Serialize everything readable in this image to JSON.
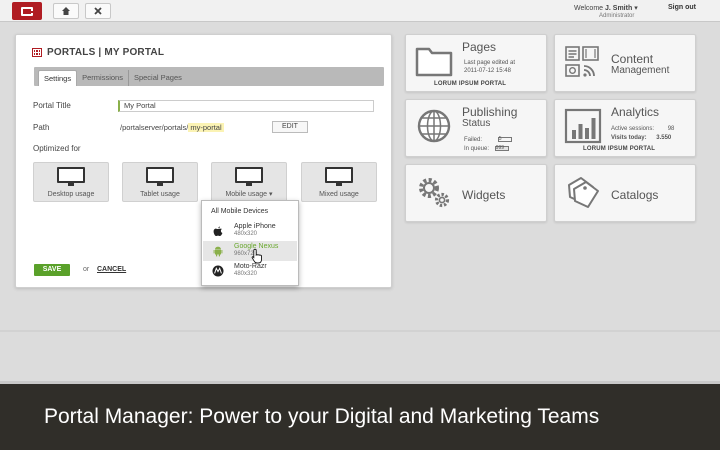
{
  "topbar": {
    "welcome_prefix": "Welcome",
    "user_name": "J. Smith",
    "user_dropdown_glyph": "▾",
    "user_role": "Administrator",
    "sign_out": "Sign out",
    "home_icon": "home-icon",
    "close_icon": "close-icon"
  },
  "portal": {
    "title": "PORTALS | MY PORTAL",
    "tabs": [
      {
        "label": "Settings",
        "active": true
      },
      {
        "label": "Permissions",
        "active": false
      },
      {
        "label": "Special Pages",
        "active": false
      }
    ],
    "portal_title_label": "Portal Title",
    "portal_title_value": "My Portal",
    "path_label": "Path",
    "path_prefix": "/portalserver/portals/",
    "path_highlight": "my-portal",
    "edit_label": "EDIT",
    "optimized_label": "Optimized for",
    "devices": [
      {
        "label": "Desktop usage"
      },
      {
        "label": "Tablet usage"
      },
      {
        "label": "Mobile usage ▾"
      },
      {
        "label": "Mixed usage"
      }
    ],
    "save_label": "SAVE",
    "or_label": "or",
    "cancel_label": "CANCEL",
    "save_color": "#5aa12a"
  },
  "mobile_menu": {
    "header": "All Mobile Devices",
    "items": [
      {
        "name": "Apple iPhone",
        "resolution": "480x320",
        "icon": "apple-icon",
        "selected": false
      },
      {
        "name": "Google Nexus",
        "resolution": "960x720",
        "icon": "android-icon",
        "selected": true
      },
      {
        "name": "Moto-Razr",
        "resolution": "480x320",
        "icon": "motorola-icon",
        "selected": false
      }
    ]
  },
  "tiles": {
    "pages": {
      "title": "Pages",
      "sub1": "Last page edited at",
      "sub2": "2011-07-12 15:48",
      "foot": "LORUM IPSUM PORTAL"
    },
    "content": {
      "title1": "Content",
      "title2": "Management"
    },
    "publishing": {
      "title1": "Publishing",
      "title2": "Status",
      "failed_label": "Failed:",
      "failed_value": "5",
      "queue_label": "In queue:",
      "queue_value": "999"
    },
    "analytics": {
      "title": "Analytics",
      "sessions_label": "Active sessions:",
      "sessions_value": "98",
      "visits_label": "Visits today:",
      "visits_value": "3.550",
      "foot": "LORUM IPSUM PORTAL"
    },
    "widgets": {
      "title": "Widgets"
    },
    "catalogs": {
      "title": "Catalogs"
    }
  },
  "caption": "Portal Manager: Power to your Digital and Marketing Teams",
  "colors": {
    "brand": "#b01c22",
    "caption_bg": "#302e29",
    "highlight": "#fbf3b4"
  }
}
